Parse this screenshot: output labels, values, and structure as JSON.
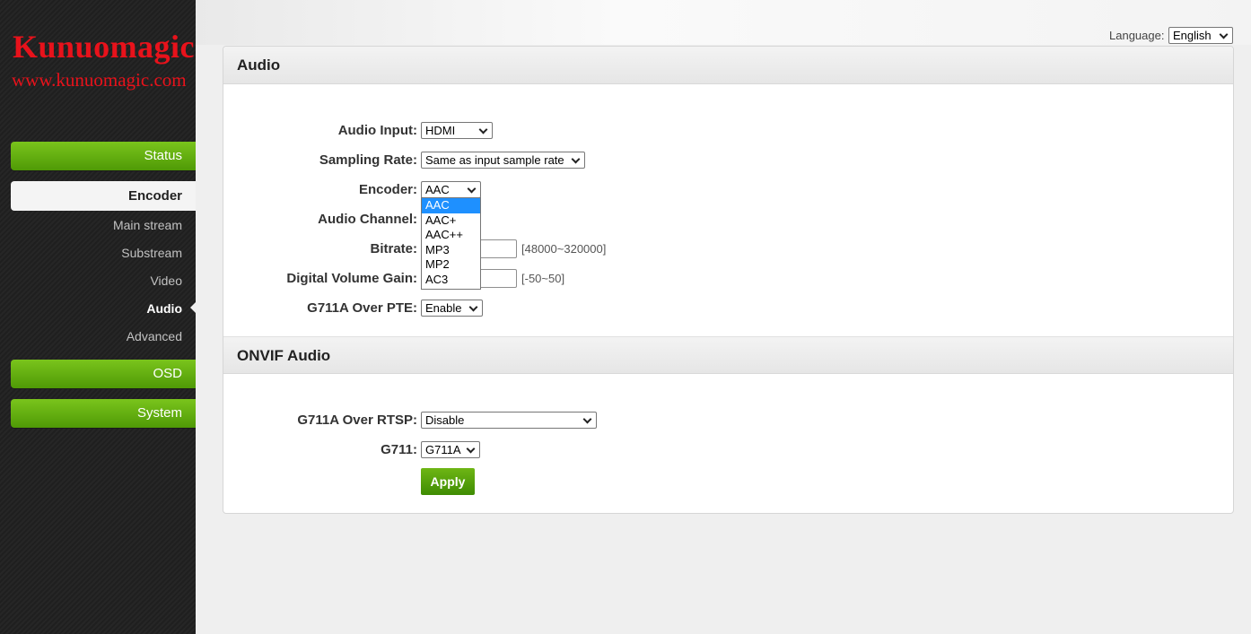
{
  "brand": {
    "name": "Kunuomagic",
    "url": "www.kunuomagic.com"
  },
  "nav": {
    "status": "Status",
    "encoder": "Encoder",
    "encoder_items": [
      "Main stream",
      "Substream",
      "Video",
      "Audio",
      "Advanced"
    ],
    "active_item": "Audio",
    "osd": "OSD",
    "system": "System"
  },
  "language": {
    "label": "Language:",
    "value": "English"
  },
  "audio": {
    "title": "Audio",
    "audio_input": {
      "label": "Audio Input:",
      "value": "HDMI"
    },
    "sampling_rate": {
      "label": "Sampling Rate:",
      "value": "Same as input sample rate"
    },
    "encoder": {
      "label": "Encoder:",
      "value": "AAC",
      "options": [
        "AAC",
        "AAC+",
        "AAC++",
        "MP3",
        "MP2",
        "AC3"
      ]
    },
    "audio_channel": {
      "label": "Audio Channel:"
    },
    "bitrate": {
      "label": "Bitrate:",
      "hint": "[48000~320000]"
    },
    "volume_gain": {
      "label": "Digital Volume Gain:",
      "hint": "[-50~50]"
    },
    "g711a_pte": {
      "label": "G711A Over PTE:",
      "value": "Enable"
    }
  },
  "onvif": {
    "title": "ONVIF Audio",
    "g711a_rtsp": {
      "label": "G711A Over RTSP:",
      "value": "Disable"
    },
    "g711": {
      "label": "G711:",
      "value": "G711A"
    }
  },
  "apply_label": "Apply",
  "colors": {
    "accent": "#5aa90c",
    "brand": "#e8121b",
    "highlight": "#1e90ff"
  }
}
